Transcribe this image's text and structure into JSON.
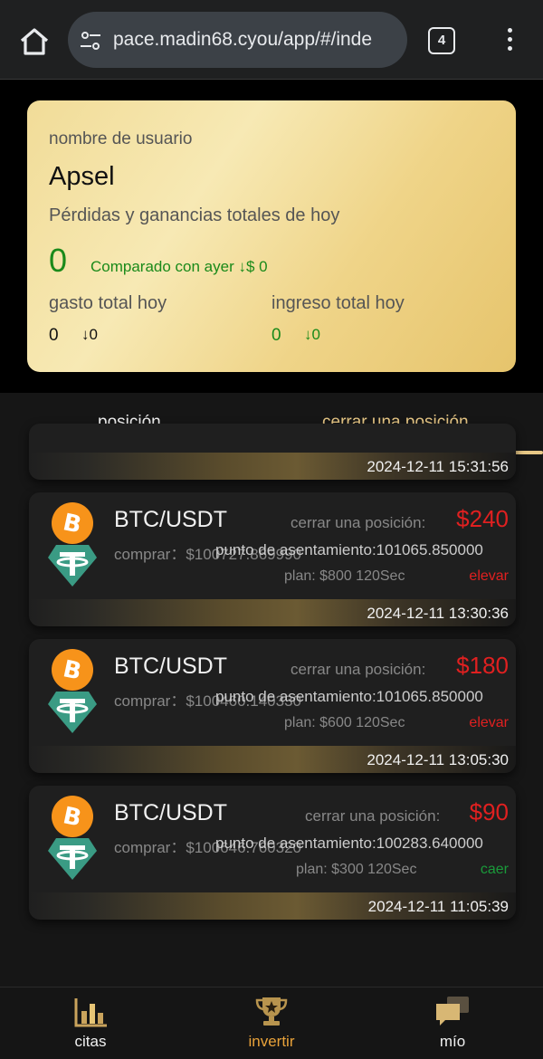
{
  "browser": {
    "url": "pace.madin68.cyou/app/#/inde",
    "tab_count": "4",
    "icons": [
      "home-icon",
      "site-settings-icon",
      "tabs-icon",
      "more-vert-icon"
    ]
  },
  "summary": {
    "username_label": "nombre de usuario",
    "username": "Apsel",
    "pnl_label": "Pérdidas y ganancias totales de hoy",
    "pnl_value": "0",
    "compare_text": "Comparado con ayer ↓$ 0",
    "spend_label": "gasto total hoy",
    "spend_value": "0",
    "spend_delta": "↓0",
    "income_label": "ingreso total hoy",
    "income_value": "0",
    "income_delta": "↓0"
  },
  "tabs": {
    "open": "posición",
    "closed": "cerrar una posición",
    "active": "closed"
  },
  "partial_row": {
    "time": "2024-12-11 15:31:56"
  },
  "orders": [
    {
      "pair": "BTC/USDT",
      "close_label": "cerrar una posición:",
      "close_amount": "$240",
      "buy_text": "comprar：$100727.869990",
      "settle_text": "punto de asentamiento:101065.850000",
      "plan_text": "plan:   $800   120Sec",
      "direction": "elevar",
      "time": "2024-12-11 13:30:36"
    },
    {
      "pair": "BTC/USDT",
      "close_label": "cerrar una posición:",
      "close_amount": "$180",
      "buy_text": "comprar：$100460.140330",
      "settle_text": "punto de asentamiento:101065.850000",
      "plan_text": "plan:   $600   120Sec",
      "direction": "elevar",
      "time": "2024-12-11 13:05:30"
    },
    {
      "pair": "BTC/USDT",
      "close_label": "cerrar una posición:",
      "close_amount": "$90",
      "buy_text": "comprar：$100646.760320",
      "settle_text": "punto de asentamiento:100283.640000",
      "plan_text": "plan:   $300   120Sec",
      "direction": "caer",
      "time": "2024-12-11 11:05:39"
    }
  ],
  "nav": {
    "quotes": "citas",
    "invest": "invertir",
    "mine": "mío",
    "active": "invest"
  },
  "colors": {
    "accent_gold": "#e8c886",
    "loss_red": "#e02020",
    "gain_green": "#1a9a3a"
  }
}
